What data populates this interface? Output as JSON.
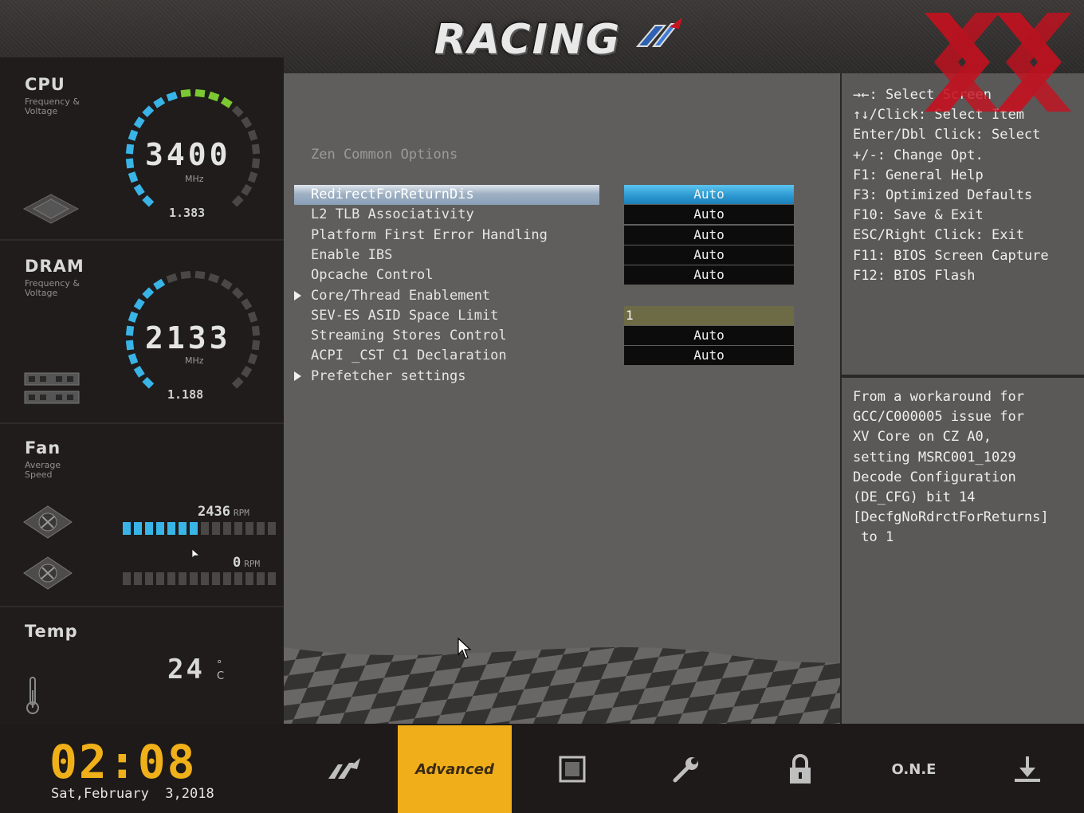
{
  "brand": {
    "logo_text": "RACING"
  },
  "sidebar": {
    "cpu": {
      "title": "CPU",
      "subtitle": "Frequency & Voltage",
      "value": "3400",
      "unit": "MHz",
      "voltage": "1.383"
    },
    "dram": {
      "title": "DRAM",
      "subtitle": "Frequency & Voltage",
      "value": "2133",
      "unit": "MHz",
      "voltage": "1.188"
    },
    "fan": {
      "title": "Fan",
      "subtitle": "Average Speed",
      "fan1_rpm": "2436",
      "fan2_rpm": "0",
      "rpm_unit": "RPM",
      "fan1_level": 0.5,
      "fan2_level": 0
    },
    "temp": {
      "title": "Temp",
      "value": "24",
      "unit": "°C"
    }
  },
  "main": {
    "section_title": "Zen Common Options",
    "items": [
      {
        "label": "RedirectForReturnDis",
        "value": "Auto",
        "selected": true
      },
      {
        "label": "L2 TLB Associativity",
        "value": "Auto"
      },
      {
        "label": "Platform First Error Handling",
        "value": "Auto"
      },
      {
        "label": "Enable IBS",
        "value": "Auto"
      },
      {
        "label": "Opcache Control",
        "value": "Auto"
      },
      {
        "label": "Core/Thread Enablement",
        "submenu": true
      },
      {
        "label": "SEV-ES ASID Space Limit",
        "value": "1",
        "input": true
      },
      {
        "label": "Streaming Stores Control",
        "value": "Auto"
      },
      {
        "label": "ACPI _CST C1 Declaration",
        "value": "Auto"
      },
      {
        "label": "Prefetcher settings",
        "submenu": true
      }
    ]
  },
  "help": {
    "lines": [
      "→←: Select Screen",
      "↑↓/Click: Select Item",
      "Enter/Dbl Click: Select",
      "+/-: Change Opt.",
      "F1: General Help",
      "F3: Optimized Defaults",
      "F10: Save & Exit",
      "ESC/Right Click: Exit",
      "F11: BIOS Screen Capture",
      "F12: BIOS Flash"
    ],
    "description": [
      "From a workaround for",
      "GCC/C000005 issue for",
      "XV Core on CZ A0,",
      "setting MSRC001_1029",
      "Decode Configuration",
      "(DE_CFG) bit 14",
      "[DecfgNoRdrctForReturns]",
      " to 1"
    ]
  },
  "bottom": {
    "time": "02:08",
    "date": "Sat,February  3,2018",
    "nav": [
      {
        "id": "main",
        "icon": "racing-logo-icon"
      },
      {
        "id": "advanced",
        "label": "Advanced",
        "active": true
      },
      {
        "id": "status",
        "icon": "chip-icon"
      },
      {
        "id": "tools",
        "icon": "wrench-icon"
      },
      {
        "id": "security",
        "icon": "lock-icon"
      },
      {
        "id": "one",
        "label": "O.N.E"
      },
      {
        "id": "exit",
        "icon": "download-icon"
      }
    ]
  },
  "colors": {
    "accent": "#39b4e6",
    "clock": "#f0b019",
    "active_tab": "#f0ae1b",
    "watermark": "#c8101e"
  }
}
